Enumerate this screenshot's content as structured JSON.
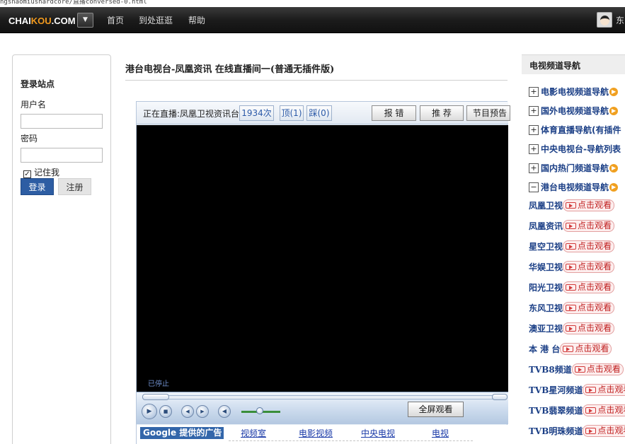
{
  "browser": {
    "path_fragment": "ngsnaomiushardcore/直播conversed-0.html"
  },
  "topbar": {
    "logo_main": "CHAI",
    "logo_accent": "KOU",
    "logo_tail": ".COM",
    "dropdown_glyph": "▼",
    "nav": [
      {
        "label": "首页"
      },
      {
        "label": "到处逛逛"
      },
      {
        "label": "帮助"
      }
    ],
    "user_label": "东"
  },
  "login": {
    "title": "登录站点",
    "username_label": "用户名",
    "username_value": "",
    "password_label": "密码",
    "password_value": "",
    "remember_label": "记住我",
    "remember_checked": "✓",
    "login_button": "登录",
    "register_button": "注册"
  },
  "main": {
    "title": "港台电视台-凤凰资讯  在线直播间一(普通无插件版)"
  },
  "player": {
    "live_label": "正在直播:凤凰卫视资讯台",
    "view_count": "1934次",
    "up_label": "顶(1)",
    "down_label": "踩(0)",
    "report_button": "报 错",
    "recommend_button": "推 荐",
    "schedule_button": "节目预告",
    "status_text": "已停止",
    "fullscreen_button": "全屏观看",
    "volume_level": 0.48
  },
  "ads": {
    "google_label": "Google 提供的广告",
    "links": [
      {
        "label": "视频室"
      },
      {
        "label": "电影视频"
      },
      {
        "label": "中央电视"
      },
      {
        "label": "电视"
      }
    ]
  },
  "sidebar": {
    "title": "电视频道导航",
    "categories": [
      {
        "sign": "+",
        "label": "电影电视频道导航",
        "arrow": "▶"
      },
      {
        "sign": "+",
        "label": "国外电视频道导航",
        "arrow": "▶"
      },
      {
        "sign": "+",
        "label": "体育直播导航(有插件",
        "arrow": ""
      },
      {
        "sign": "+",
        "label": "中央电视台-导航列表",
        "arrow": ""
      },
      {
        "sign": "+",
        "label": "国内热门频道导航",
        "arrow": "▶"
      },
      {
        "sign": "−",
        "label": "港台电视频道导航",
        "arrow": "▶"
      }
    ],
    "channels": [
      {
        "name": "凤凰卫视",
        "watch": "点击观看"
      },
      {
        "name": "凤凰资讯",
        "watch": "点击观看"
      },
      {
        "name": "星空卫视",
        "watch": "点击观看"
      },
      {
        "name": "华娱卫视",
        "watch": "点击观看"
      },
      {
        "name": "阳光卫视",
        "watch": "点击观看"
      },
      {
        "name": "东风卫视",
        "watch": "点击观看"
      },
      {
        "name": "澳亚卫视",
        "watch": "点击观看"
      },
      {
        "name": "本 港 台",
        "watch": "点击观看"
      },
      {
        "name": "TVB8频道",
        "watch": "点击观看"
      },
      {
        "name": "TVB星河频道",
        "watch": "点击观看"
      },
      {
        "name": "TVB翡翠频道",
        "watch": "点击观看"
      },
      {
        "name": "TVB明珠频道",
        "watch": "点击观看"
      }
    ]
  },
  "colors": {
    "accent": "#f29a1e",
    "login_button": "#2d5da3",
    "link": "#1b3f86",
    "watch_red": "#c02020"
  }
}
